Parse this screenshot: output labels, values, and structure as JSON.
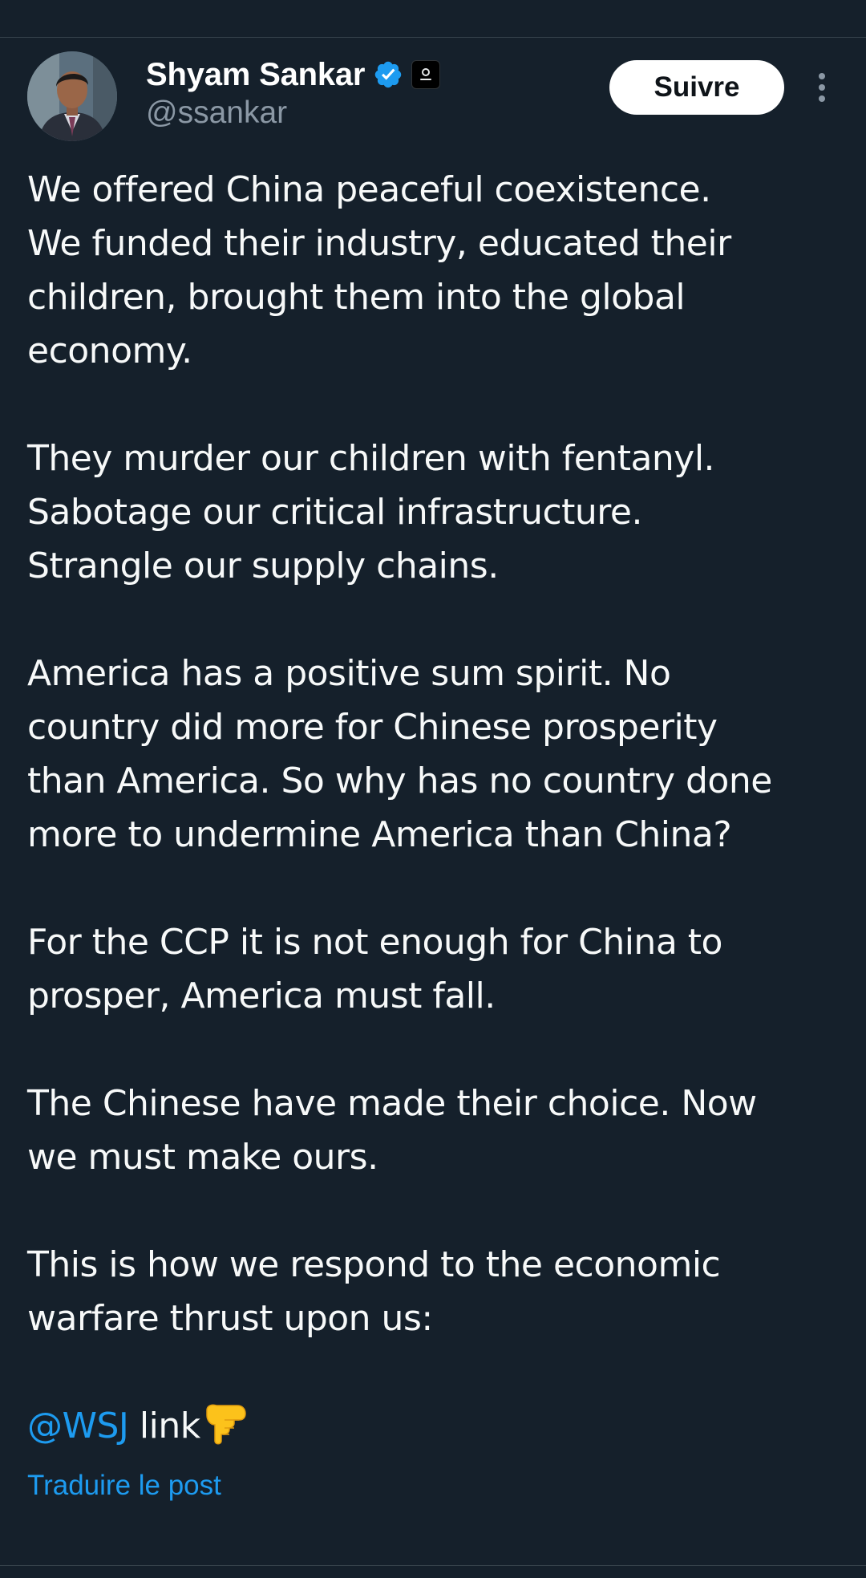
{
  "author": {
    "display_name": "Shyam Sankar",
    "handle": "@ssankar",
    "verified": true,
    "affiliate_badge": "affiliate-badge-icon"
  },
  "actions": {
    "follow_label": "Suivre",
    "more_icon": "more-vertical-icon"
  },
  "post": {
    "paragraphs": [
      "We offered China peaceful coexistence.\nWe funded their industry, educated their\nchildren, brought them into the global\neconomy.",
      "They murder our children with fentanyl.\nSabotage our critical infrastructure.\nStrangle our supply chains.",
      "America has a positive sum spirit. No\ncountry did more for Chinese prosperity\nthan America.  So why has no country done\nmore to undermine America than China?",
      "For the CCP it is not enough for China to\nprosper, America must fall.",
      "The Chinese have made their choice. Now\nwe must make ours.",
      "This is how we respond to the economic\nwarfare thrust upon us:"
    ],
    "final_line": {
      "mention": "@WSJ",
      "text": " link",
      "emoji": "backhand-index-pointing-down-icon"
    },
    "translate_label": "Traduire le post"
  },
  "colors": {
    "background": "#15202b",
    "accent": "#1d9bf0",
    "secondary_text": "#8b98a5",
    "divider": "#38444d"
  }
}
